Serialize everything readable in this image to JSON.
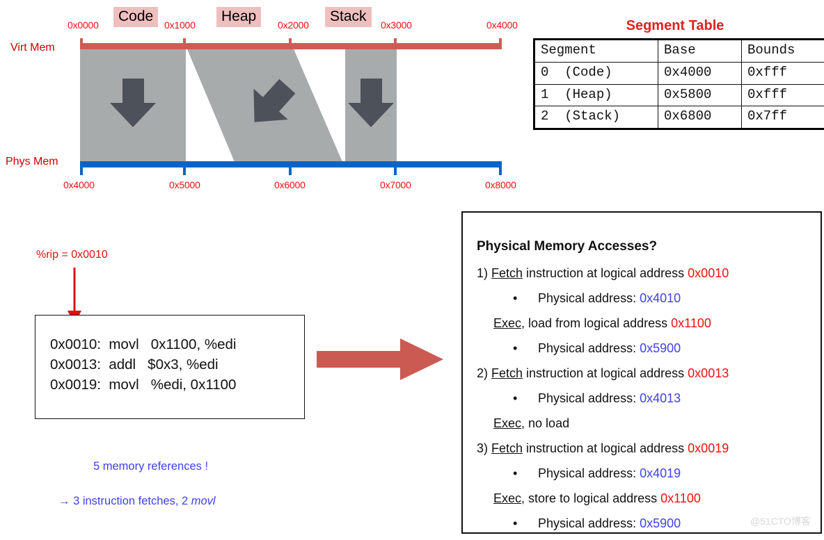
{
  "diagram": {
    "virt_label": "Virt Mem",
    "phys_label": "Phys Mem",
    "virt_addresses": [
      "0x0000",
      "0x1000",
      "0x2000",
      "0x3000",
      "0x4000"
    ],
    "phys_addresses": [
      "0x4000",
      "0x5000",
      "0x6000",
      "0x7000",
      "0x8000"
    ],
    "segments": [
      "Code",
      "Heap",
      "Stack"
    ],
    "virt_bar_color": "#CF5B55",
    "phys_bar_color": "#0A64C8",
    "segment_fill_color": "#A8ABAB",
    "arrow_color": "#4C515A",
    "chip_color": "#EFBFBF"
  },
  "segment_table": {
    "title": "Segment Table",
    "headers": [
      "Segment",
      "Base",
      "Bounds"
    ],
    "rows": [
      [
        "0  (Code)",
        "0x4000",
        "0xfff"
      ],
      [
        "1  (Heap)",
        "0x5800",
        "0xfff"
      ],
      [
        "2  (Stack)",
        "0x6800",
        "0x7ff"
      ]
    ]
  },
  "code": {
    "rip_label": "%rip = 0x0010",
    "listing": "0x0010:  movl   0x1100, %edi\n0x0013:  addl   $0x3, %edi\n0x0019:  movl   %edi, 0x1100"
  },
  "notes": {
    "line1": "5 memory references !",
    "line2_prefix": "→ 3 instruction fetches, 2 ",
    "line2_italic": "movl"
  },
  "accesses": {
    "title": "Physical Memory Accesses?",
    "lines": [
      {
        "num": "1) ",
        "verb": "Fetch",
        "text": " instruction at logical address ",
        "addr": "0x0010",
        "addr_kind": "red",
        "indent": "step"
      },
      {
        "num": "",
        "verb": "",
        "text": "Physical address: ",
        "addr": "0x4010",
        "addr_kind": "blue",
        "indent": "bullet"
      },
      {
        "num": "",
        "verb": "Exec",
        "text": ", load from logical address ",
        "addr": "0x1100",
        "addr_kind": "red",
        "indent": "exec"
      },
      {
        "num": "",
        "verb": "",
        "text": "Physical address: ",
        "addr": "0x5900",
        "addr_kind": "blue",
        "indent": "bullet"
      },
      {
        "num": "2) ",
        "verb": "Fetch",
        "text": " instruction at logical address ",
        "addr": "0x0013",
        "addr_kind": "red",
        "indent": "step"
      },
      {
        "num": "",
        "verb": "",
        "text": "Physical address: ",
        "addr": "0x4013",
        "addr_kind": "blue",
        "indent": "bullet"
      },
      {
        "num": "",
        "verb": "Exec",
        "text": ", no load",
        "addr": "",
        "addr_kind": "none",
        "indent": "exec"
      },
      {
        "num": "3) ",
        "verb": "Fetch",
        "text": " instruction at logical address ",
        "addr": "0x0019",
        "addr_kind": "red",
        "indent": "step"
      },
      {
        "num": "",
        "verb": "",
        "text": "Physical address: ",
        "addr": "0x4019",
        "addr_kind": "blue",
        "indent": "bullet"
      },
      {
        "num": "",
        "verb": "Exec",
        "text": ", store to logical address ",
        "addr": "0x1100",
        "addr_kind": "red",
        "indent": "exec"
      },
      {
        "num": "",
        "verb": "",
        "text": "Physical address: ",
        "addr": "0x5900",
        "addr_kind": "blue",
        "indent": "bullet"
      }
    ]
  },
  "watermark": "@51CTO博客"
}
